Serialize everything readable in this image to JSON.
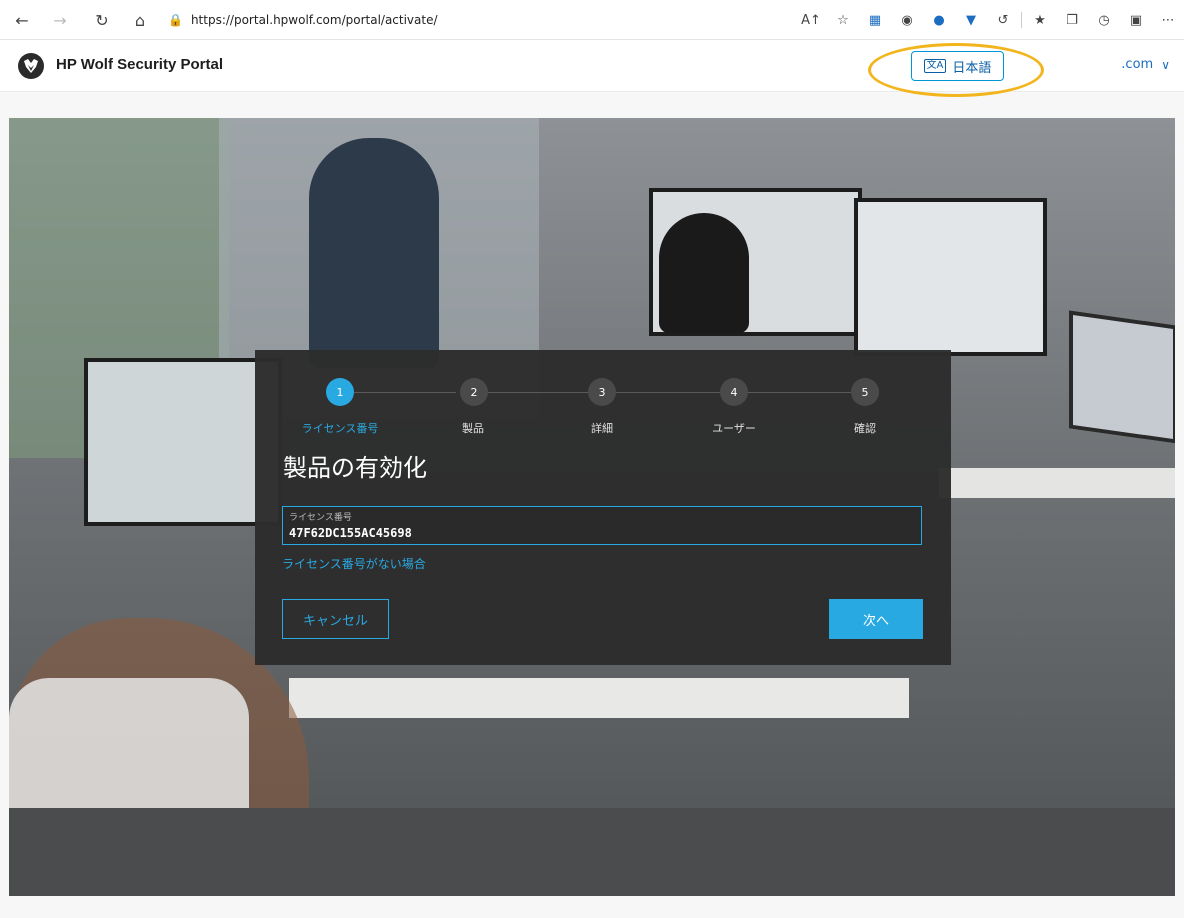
{
  "browser": {
    "url": "https://portal.hpwolf.com/portal/activate/"
  },
  "site": {
    "brand": "HP Wolf Security Portal",
    "language_button": "日本語",
    "region": ".com"
  },
  "wizard": {
    "steps": [
      {
        "number": "1",
        "label": "ライセンス番号",
        "active": true
      },
      {
        "number": "2",
        "label": "製品",
        "active": false
      },
      {
        "number": "3",
        "label": "詳細",
        "active": false
      },
      {
        "number": "4",
        "label": "ユーザー",
        "active": false
      },
      {
        "number": "5",
        "label": "確認",
        "active": false
      }
    ],
    "title": "製品の有効化",
    "license_field": {
      "label": "ライセンス番号",
      "value": "47F62DC155AC45698"
    },
    "no_license_link": "ライセンス番号がない場合",
    "cancel_label": "キャンセル",
    "next_label": "次へ"
  },
  "colors": {
    "accent": "#29a9e1",
    "highlight": "#f2b51d",
    "dialog_bg": "#2c2c2c"
  }
}
